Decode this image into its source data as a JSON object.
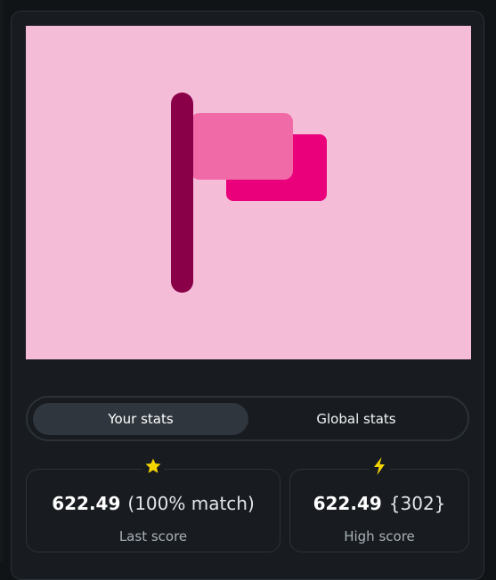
{
  "hero": {
    "background": "#f5bcd8",
    "icon": "flag-icon",
    "colors": {
      "pole": "#8a0048",
      "flag_front": "#f06aa8",
      "flag_back": "#ea007a"
    }
  },
  "toggle": {
    "your_stats": "Your stats",
    "global_stats": "Global stats"
  },
  "stats": [
    {
      "icon": "star-icon",
      "value": "622.49",
      "detail": "(100% match)",
      "label": "Last score",
      "icon_color": "#f3d400"
    },
    {
      "icon": "lightning-icon",
      "value": "622.49",
      "detail": "{302}",
      "label": "High score",
      "icon_color": "#f3d400"
    }
  ]
}
